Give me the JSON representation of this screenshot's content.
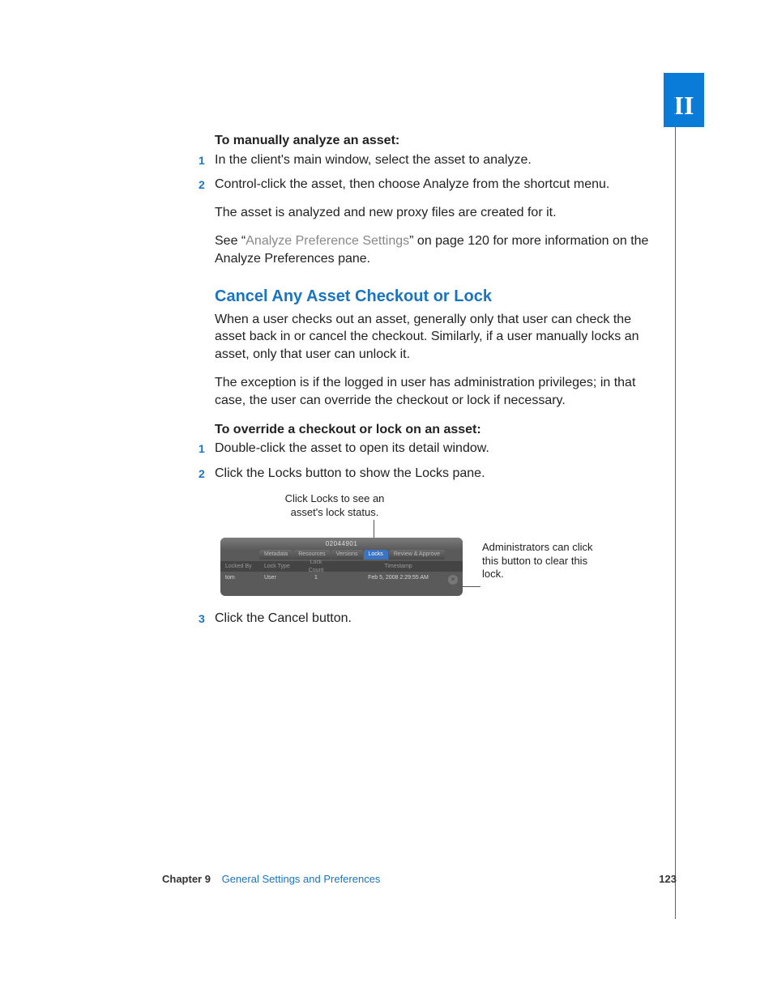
{
  "part_tab": "II",
  "section1_title": "To manually analyze an asset:",
  "steps1": [
    "In the client's main window, select the asset to analyze.",
    "Control-click the asset, then choose Analyze from the shortcut menu."
  ],
  "para_after_steps1_a": "The asset is analyzed and new proxy files are created for it.",
  "para_see_prefix": "See “",
  "link_text": "Analyze Preference Settings",
  "para_see_suffix": "” on page 120 for more information on the Analyze Preferences pane.",
  "h2": "Cancel Any Asset Checkout or Lock",
  "para_cancel_1": "When a user checks out an asset, generally only that user can check the asset back in or cancel the checkout. Similarly, if a user manually locks an asset, only that user can unlock it.",
  "para_cancel_2": "The exception is if the logged in user has administration privileges; in that case, the user can override the checkout or lock if necessary.",
  "section2_title": "To override a checkout or lock on an asset:",
  "steps2": [
    "Double-click the asset to open its detail window.",
    "Click the Locks button to show the Locks pane."
  ],
  "callout_top": "Click Locks to see an asset's lock status.",
  "callout_right": "Administrators can click this button to clear this lock.",
  "steps3": [
    "Click the Cancel button."
  ],
  "figure": {
    "window_title": "02044901",
    "tabs": [
      "Metadata",
      "Resources",
      "Versions",
      "Locks",
      "Review & Approve"
    ],
    "active_tab": "Locks",
    "columns": [
      "Locked By",
      "Lock Type",
      "Lock Count",
      "Timestamp"
    ],
    "row": {
      "locked_by": "tom",
      "lock_type": "User",
      "lock_count": "1",
      "timestamp": "Feb 5, 2008 2:29:55 AM"
    }
  },
  "footer": {
    "chapter_label": "Chapter 9",
    "chapter_title": "General Settings and Preferences",
    "page": "123"
  }
}
